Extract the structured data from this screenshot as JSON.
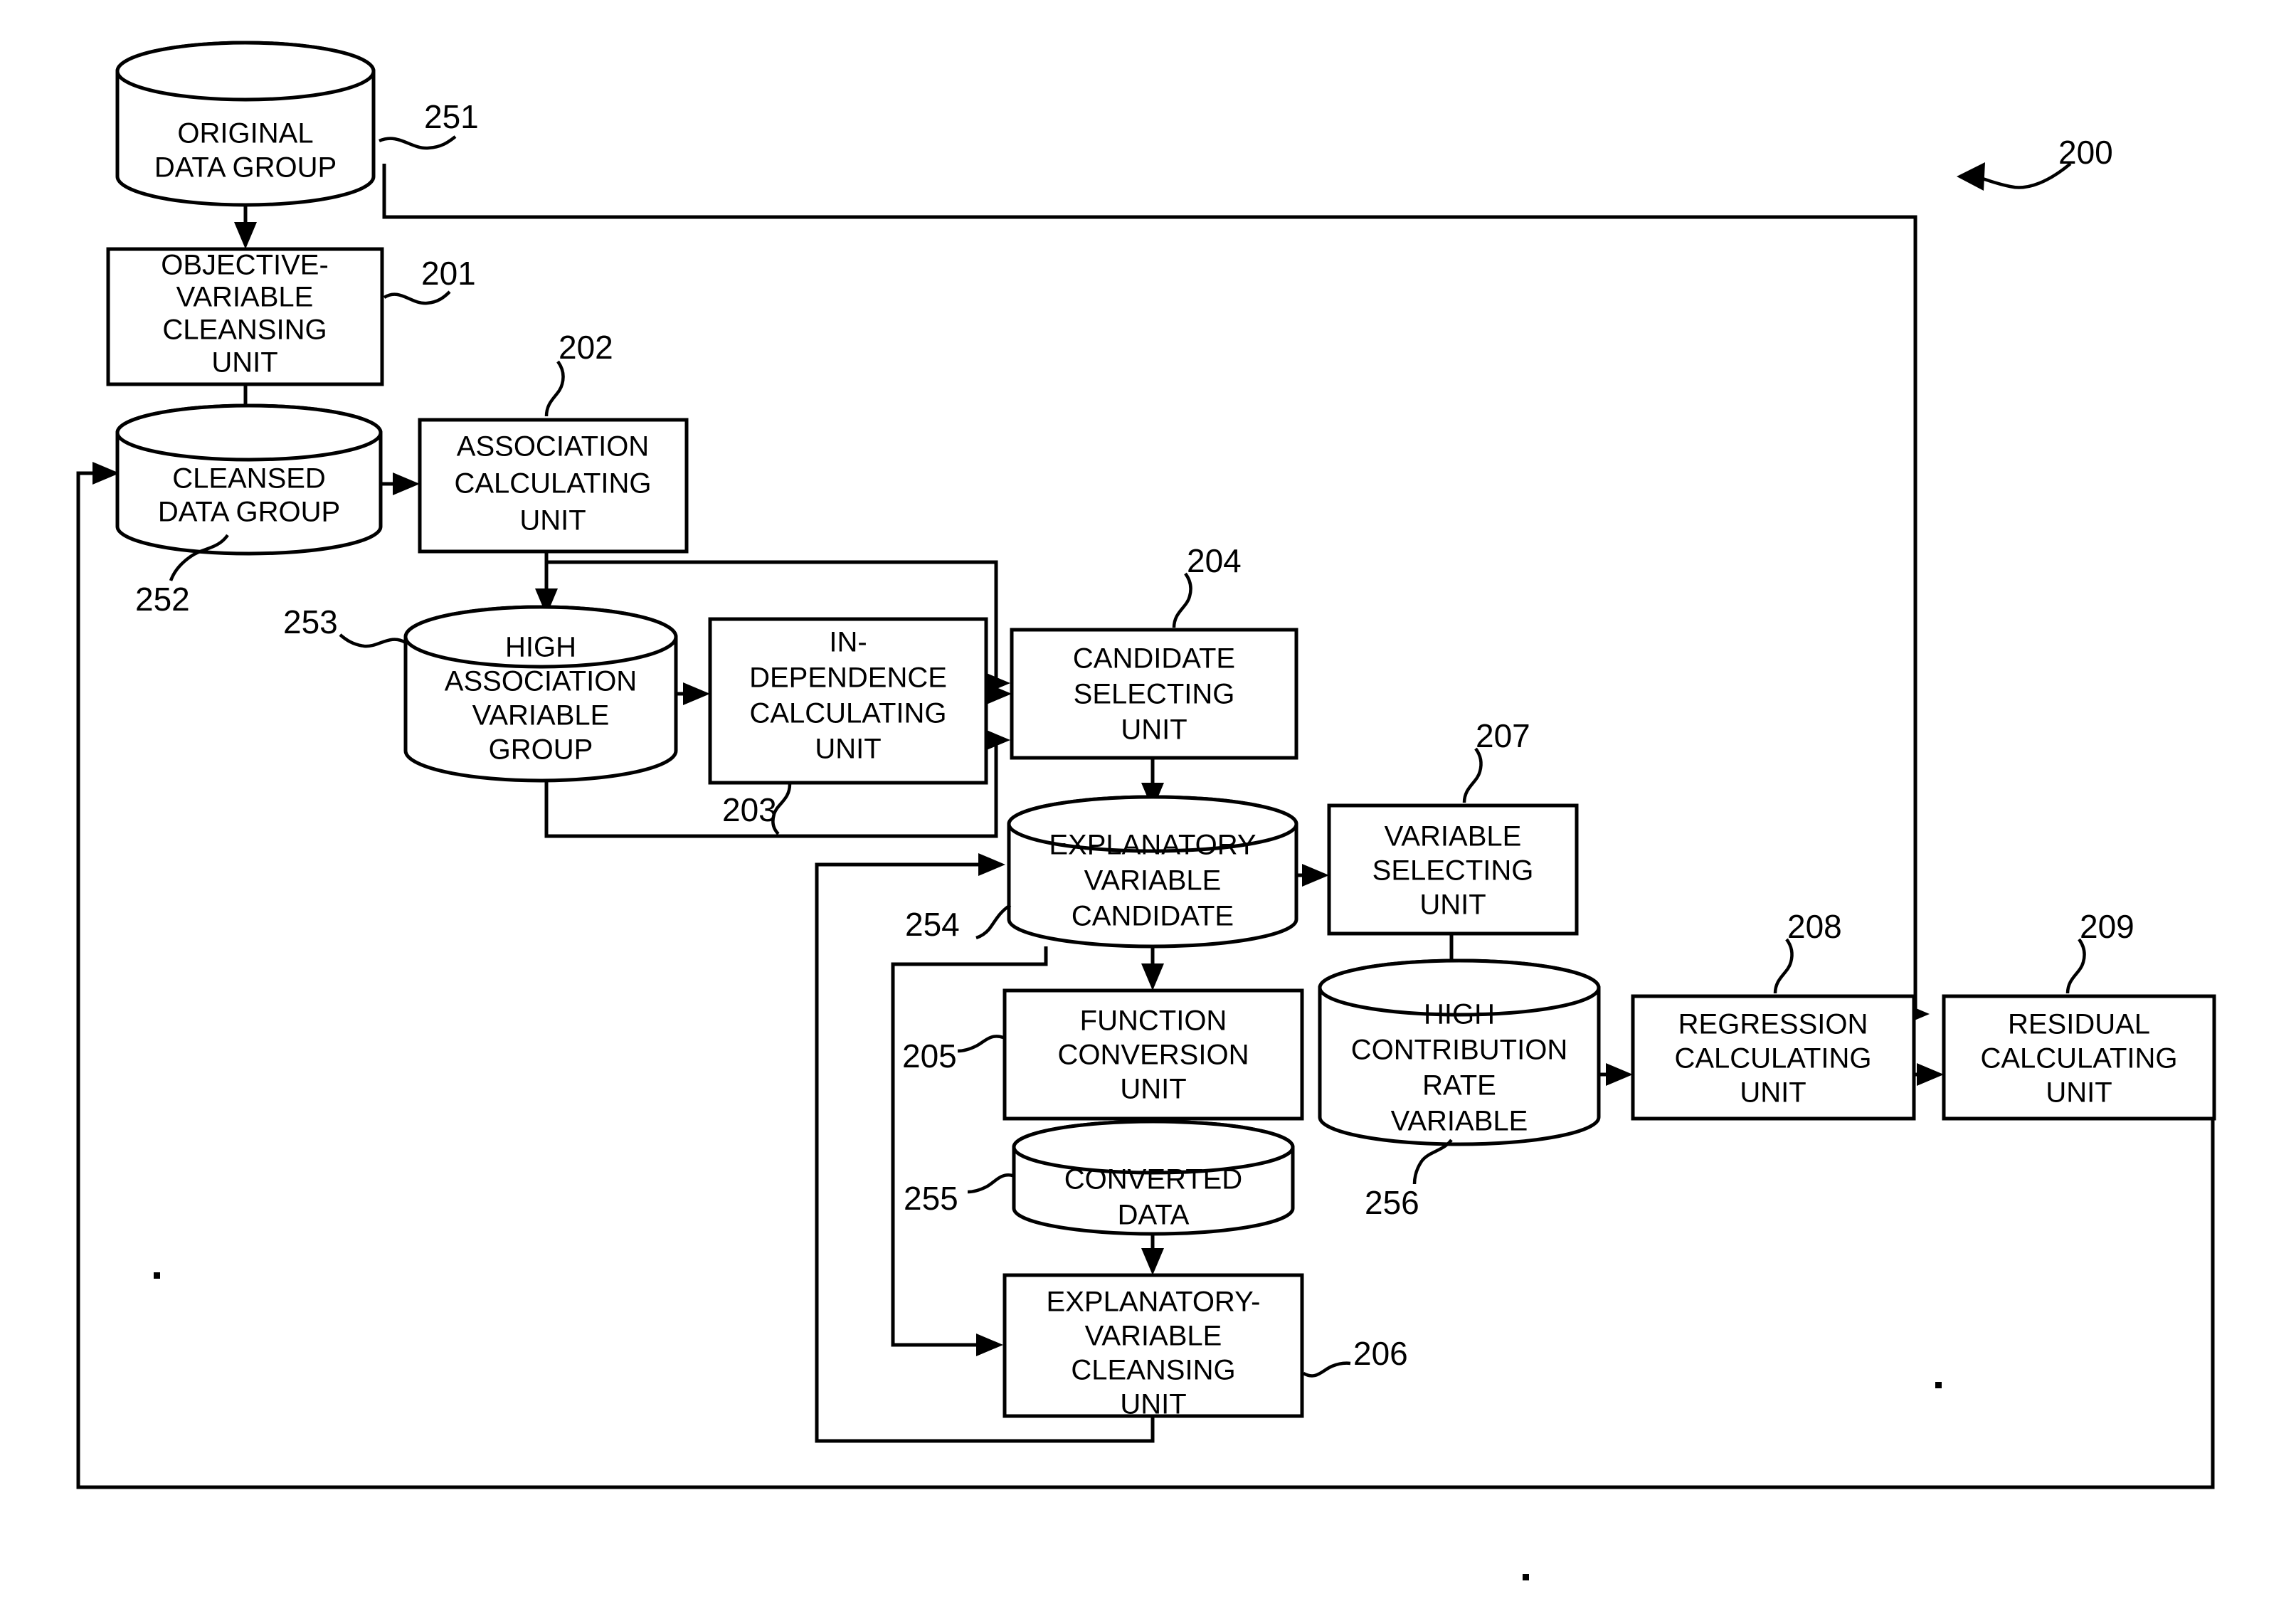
{
  "figure": {
    "system_ref": "200",
    "nodes": [
      {
        "id": "original_data_group",
        "ref": "251",
        "type": "cylinder",
        "lines": [
          "ORIGINAL",
          "DATA GROUP"
        ]
      },
      {
        "id": "objective_variable_cleansing_unit",
        "ref": "201",
        "type": "box",
        "lines": [
          "OBJECTIVE-",
          "VARIABLE",
          "CLEANSING",
          "UNIT"
        ]
      },
      {
        "id": "cleansed_data_group",
        "ref": "252",
        "type": "cylinder",
        "lines": [
          "CLEANSED",
          "DATA GROUP"
        ]
      },
      {
        "id": "association_calculating_unit",
        "ref": "202",
        "type": "box",
        "lines": [
          "ASSOCIATION",
          "CALCULATING",
          "UNIT"
        ]
      },
      {
        "id": "high_association_variable_group",
        "ref": "253",
        "type": "cylinder",
        "lines": [
          "HIGH",
          "ASSOCIATION",
          "VARIABLE",
          "GROUP"
        ]
      },
      {
        "id": "independence_calculating_unit",
        "ref": "203",
        "type": "box",
        "lines": [
          "IN-",
          "DEPENDENCE",
          "CALCULATING",
          "UNIT"
        ]
      },
      {
        "id": "candidate_selecting_unit",
        "ref": "204",
        "type": "box",
        "lines": [
          "CANDIDATE",
          "SELECTING",
          "UNIT"
        ]
      },
      {
        "id": "explanatory_variable_candidate",
        "ref": "254",
        "type": "cylinder",
        "lines": [
          "EXPLANATORY",
          "VARIABLE",
          "CANDIDATE"
        ]
      },
      {
        "id": "variable_selecting_unit",
        "ref": "207",
        "type": "box",
        "lines": [
          "VARIABLE",
          "SELECTING",
          "UNIT"
        ]
      },
      {
        "id": "function_conversion_unit",
        "ref": "205",
        "type": "box",
        "lines": [
          "FUNCTION",
          "CONVERSION",
          "UNIT"
        ]
      },
      {
        "id": "high_contribution_rate_variable",
        "ref": "256",
        "type": "cylinder",
        "lines": [
          "HIGH",
          "CONTRIBUTION",
          "RATE",
          "VARIABLE"
        ]
      },
      {
        "id": "regression_calculating_unit",
        "ref": "208",
        "type": "box",
        "lines": [
          "REGRESSION",
          "CALCULATING",
          "UNIT"
        ]
      },
      {
        "id": "residual_calculating_unit",
        "ref": "209",
        "type": "box",
        "lines": [
          "RESIDUAL",
          "CALCULATING",
          "UNIT"
        ]
      },
      {
        "id": "converted_data",
        "ref": "255",
        "type": "cylinder",
        "lines": [
          "CONVERTED",
          "DATA"
        ]
      },
      {
        "id": "explanatory_variable_cleansing_unit",
        "ref": "206",
        "type": "box",
        "lines": [
          "EXPLANATORY-",
          "VARIABLE",
          "CLEANSING",
          "UNIT"
        ]
      }
    ]
  },
  "text": {
    "original_data_group_l1": "ORIGINAL",
    "original_data_group_l2": "DATA GROUP",
    "objective_variable_cleansing_unit_l1": "OBJECTIVE-",
    "objective_variable_cleansing_unit_l2": "VARIABLE",
    "objective_variable_cleansing_unit_l3": "CLEANSING",
    "objective_variable_cleansing_unit_l4": "UNIT",
    "cleansed_data_group_l1": "CLEANSED",
    "cleansed_data_group_l2": "DATA GROUP",
    "association_calculating_unit_l1": "ASSOCIATION",
    "association_calculating_unit_l2": "CALCULATING",
    "association_calculating_unit_l3": "UNIT",
    "high_association_variable_group_l1": "HIGH",
    "high_association_variable_group_l2": "ASSOCIATION",
    "high_association_variable_group_l3": "VARIABLE",
    "high_association_variable_group_l4": "GROUP",
    "independence_calculating_unit_l1": "IN-",
    "independence_calculating_unit_l2": "DEPENDENCE",
    "independence_calculating_unit_l3": "CALCULATING",
    "independence_calculating_unit_l4": "UNIT",
    "candidate_selecting_unit_l1": "CANDIDATE",
    "candidate_selecting_unit_l2": "SELECTING",
    "candidate_selecting_unit_l3": "UNIT",
    "explanatory_variable_candidate_l1": "EXPLANATORY",
    "explanatory_variable_candidate_l2": "VARIABLE",
    "explanatory_variable_candidate_l3": "CANDIDATE",
    "variable_selecting_unit_l1": "VARIABLE",
    "variable_selecting_unit_l2": "SELECTING",
    "variable_selecting_unit_l3": "UNIT",
    "function_conversion_unit_l1": "FUNCTION",
    "function_conversion_unit_l2": "CONVERSION",
    "function_conversion_unit_l3": "UNIT",
    "high_contribution_rate_variable_l1": "HIGH",
    "high_contribution_rate_variable_l2": "CONTRIBUTION",
    "high_contribution_rate_variable_l3": "RATE",
    "high_contribution_rate_variable_l4": "VARIABLE",
    "regression_calculating_unit_l1": "REGRESSION",
    "regression_calculating_unit_l2": "CALCULATING",
    "regression_calculating_unit_l3": "UNIT",
    "residual_calculating_unit_l1": "RESIDUAL",
    "residual_calculating_unit_l2": "CALCULATING",
    "residual_calculating_unit_l3": "UNIT",
    "converted_data_l1": "CONVERTED",
    "converted_data_l2": "DATA",
    "explanatory_variable_cleansing_unit_l1": "EXPLANATORY-",
    "explanatory_variable_cleansing_unit_l2": "VARIABLE",
    "explanatory_variable_cleansing_unit_l3": "CLEANSING",
    "explanatory_variable_cleansing_unit_l4": "UNIT"
  },
  "refs": {
    "system": "200",
    "original_data_group": "251",
    "objective_variable_cleansing_unit": "201",
    "cleansed_data_group": "252",
    "association_calculating_unit": "202",
    "high_association_variable_group": "253",
    "independence_calculating_unit": "203",
    "candidate_selecting_unit": "204",
    "explanatory_variable_candidate": "254",
    "variable_selecting_unit": "207",
    "function_conversion_unit": "205",
    "high_contribution_rate_variable": "256",
    "regression_calculating_unit": "208",
    "residual_calculating_unit": "209",
    "converted_data": "255",
    "explanatory_variable_cleansing_unit": "206"
  },
  "colors": {
    "ink": "#000000",
    "paper": "#ffffff"
  }
}
